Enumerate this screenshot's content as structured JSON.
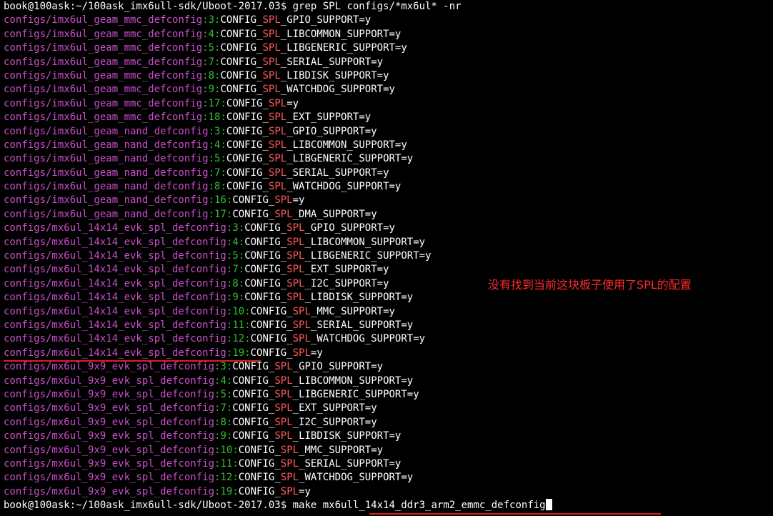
{
  "colors": {
    "background": "#000000",
    "text": "#ffffff",
    "filename": "#c84fc8",
    "line_number": "#2fc02f",
    "match_highlight": "#ff5a5a",
    "annotation": "#ff2a2a",
    "underline": "#e01c1c"
  },
  "prompt": {
    "user_host": "book@100ask",
    "path": ":~/100ask_imx6ull-sdk/Uboot-2017.03$"
  },
  "commands": {
    "grep": "grep SPL configs/*mx6ul* -nr",
    "make_prefix": "make ",
    "make_target": "mx6ull_14x14_ddr3_arm2_emmc_defconfig"
  },
  "results": [
    {
      "file": "configs/imx6ul_geam_mmc_defconfig",
      "line": "3",
      "pre": "CONFIG_",
      "match": "SPL",
      "post": "_GPIO_SUPPORT=y"
    },
    {
      "file": "configs/imx6ul_geam_mmc_defconfig",
      "line": "4",
      "pre": "CONFIG_",
      "match": "SPL",
      "post": "_LIBCOMMON_SUPPORT=y"
    },
    {
      "file": "configs/imx6ul_geam_mmc_defconfig",
      "line": "5",
      "pre": "CONFIG_",
      "match": "SPL",
      "post": "_LIBGENERIC_SUPPORT=y"
    },
    {
      "file": "configs/imx6ul_geam_mmc_defconfig",
      "line": "7",
      "pre": "CONFIG_",
      "match": "SPL",
      "post": "_SERIAL_SUPPORT=y"
    },
    {
      "file": "configs/imx6ul_geam_mmc_defconfig",
      "line": "8",
      "pre": "CONFIG_",
      "match": "SPL",
      "post": "_LIBDISK_SUPPORT=y"
    },
    {
      "file": "configs/imx6ul_geam_mmc_defconfig",
      "line": "9",
      "pre": "CONFIG_",
      "match": "SPL",
      "post": "_WATCHDOG_SUPPORT=y"
    },
    {
      "file": "configs/imx6ul_geam_mmc_defconfig",
      "line": "17",
      "pre": "CONFIG_",
      "match": "SPL",
      "post": "=y"
    },
    {
      "file": "configs/imx6ul_geam_mmc_defconfig",
      "line": "18",
      "pre": "CONFIG_",
      "match": "SPL",
      "post": "_EXT_SUPPORT=y"
    },
    {
      "file": "configs/imx6ul_geam_nand_defconfig",
      "line": "3",
      "pre": "CONFIG_",
      "match": "SPL",
      "post": "_GPIO_SUPPORT=y"
    },
    {
      "file": "configs/imx6ul_geam_nand_defconfig",
      "line": "4",
      "pre": "CONFIG_",
      "match": "SPL",
      "post": "_LIBCOMMON_SUPPORT=y"
    },
    {
      "file": "configs/imx6ul_geam_nand_defconfig",
      "line": "5",
      "pre": "CONFIG_",
      "match": "SPL",
      "post": "_LIBGENERIC_SUPPORT=y"
    },
    {
      "file": "configs/imx6ul_geam_nand_defconfig",
      "line": "7",
      "pre": "CONFIG_",
      "match": "SPL",
      "post": "_SERIAL_SUPPORT=y"
    },
    {
      "file": "configs/imx6ul_geam_nand_defconfig",
      "line": "8",
      "pre": "CONFIG_",
      "match": "SPL",
      "post": "_WATCHDOG_SUPPORT=y"
    },
    {
      "file": "configs/imx6ul_geam_nand_defconfig",
      "line": "16",
      "pre": "CONFIG_",
      "match": "SPL",
      "post": "=y"
    },
    {
      "file": "configs/imx6ul_geam_nand_defconfig",
      "line": "17",
      "pre": "CONFIG_",
      "match": "SPL",
      "post": "_DMA_SUPPORT=y"
    },
    {
      "file": "configs/mx6ul_14x14_evk_spl_defconfig",
      "line": "3",
      "pre": "CONFIG_",
      "match": "SPL",
      "post": "_GPIO_SUPPORT=y"
    },
    {
      "file": "configs/mx6ul_14x14_evk_spl_defconfig",
      "line": "4",
      "pre": "CONFIG_",
      "match": "SPL",
      "post": "_LIBCOMMON_SUPPORT=y"
    },
    {
      "file": "configs/mx6ul_14x14_evk_spl_defconfig",
      "line": "5",
      "pre": "CONFIG_",
      "match": "SPL",
      "post": "_LIBGENERIC_SUPPORT=y"
    },
    {
      "file": "configs/mx6ul_14x14_evk_spl_defconfig",
      "line": "7",
      "pre": "CONFIG_",
      "match": "SPL",
      "post": "_EXT_SUPPORT=y"
    },
    {
      "file": "configs/mx6ul_14x14_evk_spl_defconfig",
      "line": "8",
      "pre": "CONFIG_",
      "match": "SPL",
      "post": "_I2C_SUPPORT=y"
    },
    {
      "file": "configs/mx6ul_14x14_evk_spl_defconfig",
      "line": "9",
      "pre": "CONFIG_",
      "match": "SPL",
      "post": "_LIBDISK_SUPPORT=y"
    },
    {
      "file": "configs/mx6ul_14x14_evk_spl_defconfig",
      "line": "10",
      "pre": "CONFIG_",
      "match": "SPL",
      "post": "_MMC_SUPPORT=y"
    },
    {
      "file": "configs/mx6ul_14x14_evk_spl_defconfig",
      "line": "11",
      "pre": "CONFIG_",
      "match": "SPL",
      "post": "_SERIAL_SUPPORT=y"
    },
    {
      "file": "configs/mx6ul_14x14_evk_spl_defconfig",
      "line": "12",
      "pre": "CONFIG_",
      "match": "SPL",
      "post": "_WATCHDOG_SUPPORT=y"
    },
    {
      "file": "configs/mx6ul_14x14_evk_spl_defconfig",
      "line": "19",
      "pre": "CONFIG_",
      "match": "SPL",
      "post": "=y"
    },
    {
      "file": "configs/mx6ul_9x9_evk_spl_defconfig",
      "line": "3",
      "pre": "CONFIG_",
      "match": "SPL",
      "post": "_GPIO_SUPPORT=y"
    },
    {
      "file": "configs/mx6ul_9x9_evk_spl_defconfig",
      "line": "4",
      "pre": "CONFIG_",
      "match": "SPL",
      "post": "_LIBCOMMON_SUPPORT=y"
    },
    {
      "file": "configs/mx6ul_9x9_evk_spl_defconfig",
      "line": "5",
      "pre": "CONFIG_",
      "match": "SPL",
      "post": "_LIBGENERIC_SUPPORT=y"
    },
    {
      "file": "configs/mx6ul_9x9_evk_spl_defconfig",
      "line": "7",
      "pre": "CONFIG_",
      "match": "SPL",
      "post": "_EXT_SUPPORT=y"
    },
    {
      "file": "configs/mx6ul_9x9_evk_spl_defconfig",
      "line": "8",
      "pre": "CONFIG_",
      "match": "SPL",
      "post": "_I2C_SUPPORT=y"
    },
    {
      "file": "configs/mx6ul_9x9_evk_spl_defconfig",
      "line": "9",
      "pre": "CONFIG_",
      "match": "SPL",
      "post": "_LIBDISK_SUPPORT=y"
    },
    {
      "file": "configs/mx6ul_9x9_evk_spl_defconfig",
      "line": "10",
      "pre": "CONFIG_",
      "match": "SPL",
      "post": "_MMC_SUPPORT=y"
    },
    {
      "file": "configs/mx6ul_9x9_evk_spl_defconfig",
      "line": "11",
      "pre": "CONFIG_",
      "match": "SPL",
      "post": "_SERIAL_SUPPORT=y"
    },
    {
      "file": "configs/mx6ul_9x9_evk_spl_defconfig",
      "line": "12",
      "pre": "CONFIG_",
      "match": "SPL",
      "post": "_WATCHDOG_SUPPORT=y"
    },
    {
      "file": "configs/mx6ul_9x9_evk_spl_defconfig",
      "line": "19",
      "pre": "CONFIG_",
      "match": "SPL",
      "post": "=y"
    }
  ],
  "annotation": "没有找到当前这块板子使用了SPL的配置",
  "underlined_result_index": 24
}
